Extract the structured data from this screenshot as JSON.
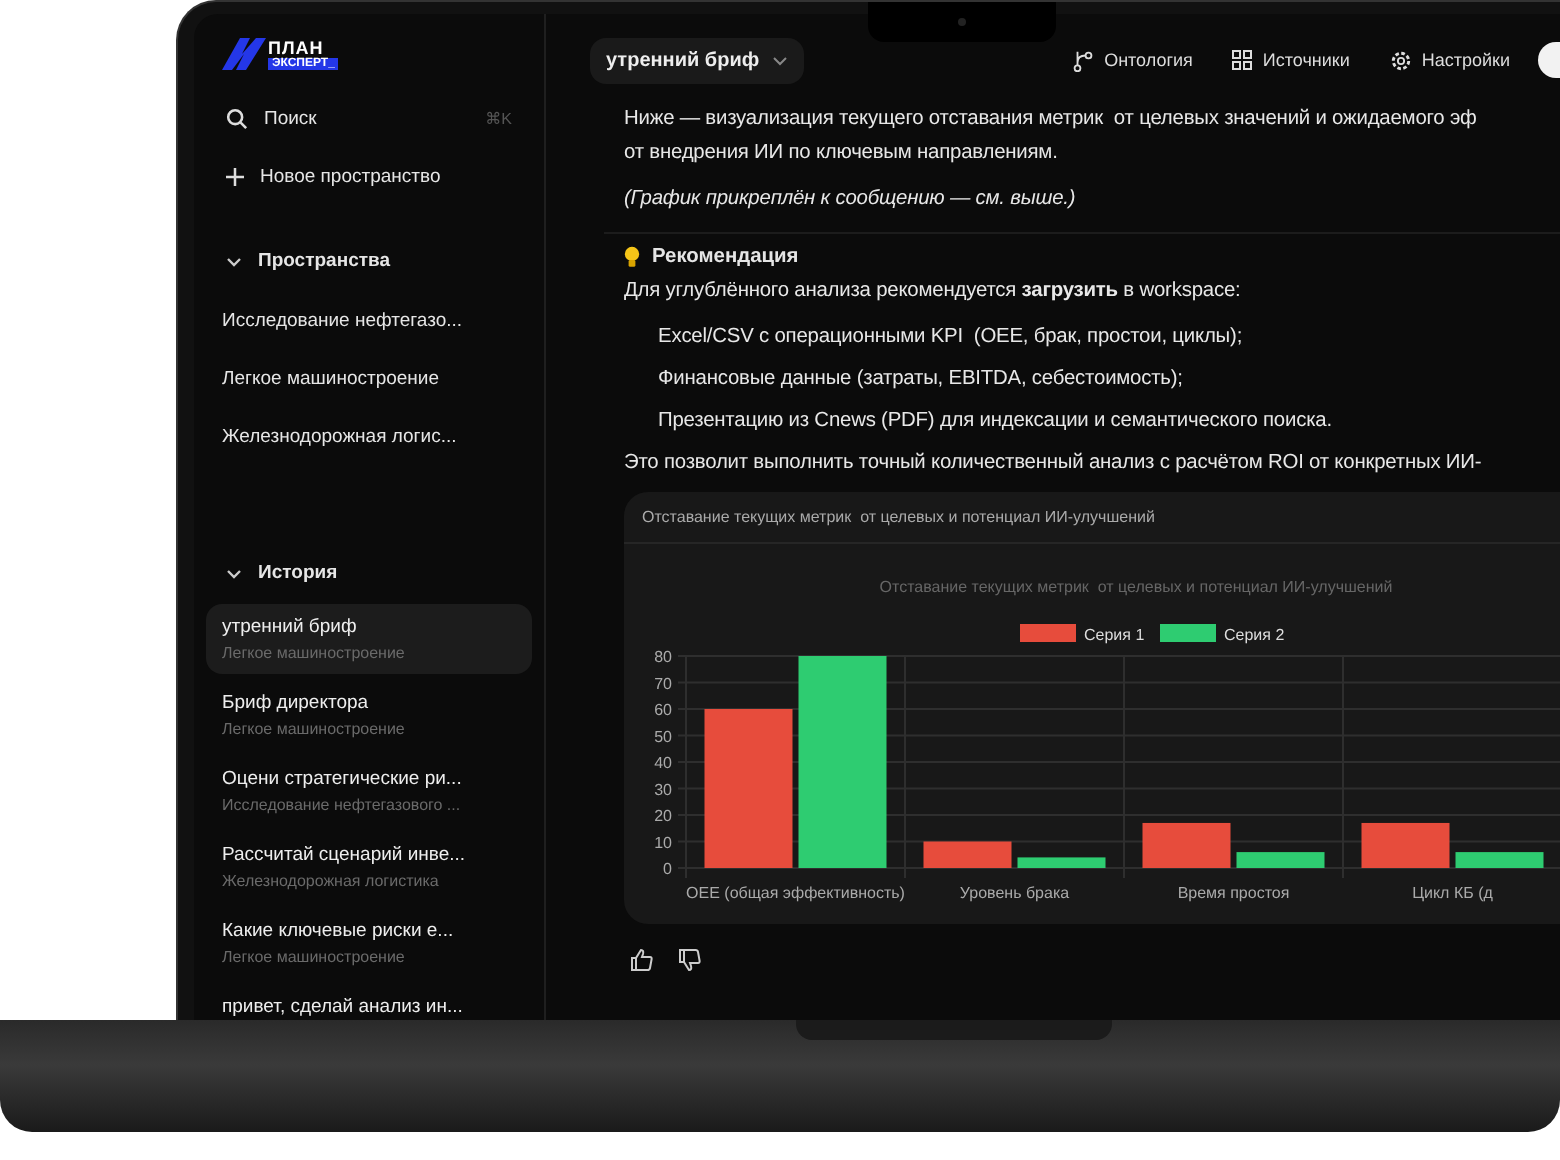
{
  "logo": {
    "line1": "ПЛАН",
    "line2": "ЭКСПЕРТ_"
  },
  "sidebar": {
    "search": {
      "label": "Поиск",
      "shortcut": "⌘K"
    },
    "new_space": "Новое пространство",
    "sections": [
      {
        "title": "Пространства",
        "expanded": true,
        "items": [
          {
            "title": "Исследование нефтегазо...",
            "selected": false
          },
          {
            "title": "Легкое машиностроение",
            "selected": false
          },
          {
            "title": "Железнодорожная логис...",
            "selected": false
          }
        ]
      },
      {
        "title": "История",
        "expanded": true,
        "items": [
          {
            "title": "утренний бриф",
            "subtitle": "Легкое машиностроение",
            "selected": true
          },
          {
            "title": "Бриф директора",
            "subtitle": "Легкое машиностроение",
            "selected": false
          },
          {
            "title": "Оцени стратегические ри...",
            "subtitle": "Исследование нефтегазового ...",
            "selected": false
          },
          {
            "title": "Рассчитай сценарий инве...",
            "subtitle": "Железнодорожная логистика",
            "selected": false
          },
          {
            "title": "Какие ключевые риски е...",
            "subtitle": "Легкое машиностроение",
            "selected": false
          },
          {
            "title": "привет, сделай анализ ин...",
            "selected": false
          }
        ]
      }
    ]
  },
  "header": {
    "chat_title": "утренний бриф",
    "nav": [
      {
        "kind": "ontology",
        "label": "Онтология"
      },
      {
        "kind": "sources",
        "label": "Источники"
      },
      {
        "kind": "settings",
        "label": "Настройки"
      }
    ]
  },
  "message": {
    "blocks": [
      {
        "kind": "paragraph",
        "text": "Ниже — визуализация текущего отставания метрик  от целевых значений и ожидаемого эф\nот внедрения ИИ по ключевым направлениям."
      },
      {
        "kind": "note",
        "text": "(График прикреплён к сообщению — см. выше.)"
      },
      {
        "kind": "divider"
      },
      {
        "kind": "heading",
        "text": "Рекомендация"
      },
      {
        "kind": "paragraph",
        "text": "Для углублённого анализа рекомендуется **загрузить** в workspace:"
      },
      {
        "kind": "list",
        "items": [
          "Excel/CSV с операционными KPI  (OEE, брак, простои, циклы);",
          "Финансовые данные (затраты, EBITDA, себестоимость);",
          "Презентацию из Cnews (PDF) для индексации и семантического поиска."
        ]
      },
      {
        "kind": "paragraph",
        "text": "Это позволит выполнить точный количественный анализ с расчётом ROI от конкретных ИИ-"
      }
    ],
    "chart_card": {
      "title": "Отставание текущих метрик  от целевых и потенциал ИИ-улучшений",
      "chart_data": {
        "type": "bar",
        "title": "Отставание текущих метрик  от целевых и потенциал ИИ-улучшений",
        "categories": [
          "OEE (общая эффективность)",
          "Уровень брака",
          "Время простоя",
          "Цикл КБ (д"
        ],
        "series": [
          {
            "name": "Серия 1",
            "color": "#e74c3c",
            "values": [
              60,
              10,
              17,
              17
            ]
          },
          {
            "name": "Серия 2",
            "color": "#2ecc71",
            "values": [
              80,
              4,
              6,
              6
            ]
          }
        ],
        "grid": true,
        "legend": true,
        "ylim": [
          0,
          80
        ],
        "yticks": [
          0,
          10,
          20,
          30,
          40,
          50,
          60,
          70,
          80
        ]
      }
    }
  }
}
